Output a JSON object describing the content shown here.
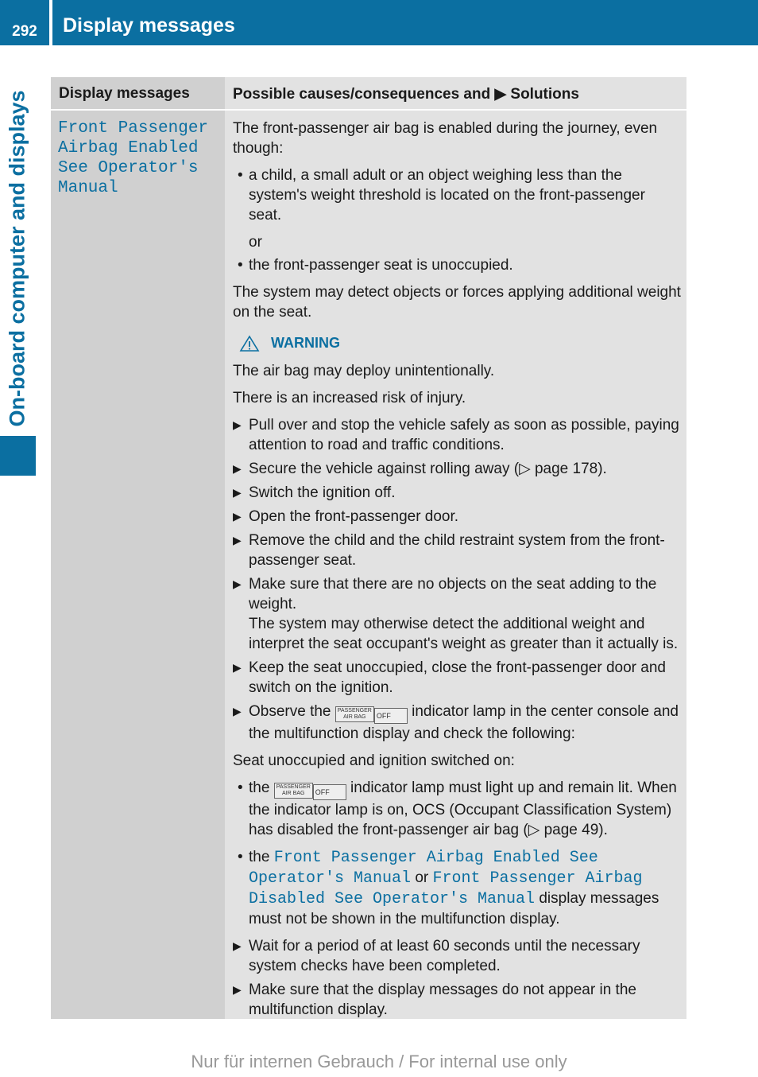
{
  "header": {
    "page_number": "292",
    "section_title": "Display messages"
  },
  "sidebar": {
    "label": "On-board computer and displays"
  },
  "colors": {
    "brand_blue": "#0b6fa1",
    "table_left_bg": "#d0d0d0",
    "table_right_bg": "#e2e2e2"
  },
  "table": {
    "headers": {
      "left": "Display messages",
      "right_prefix": "Possible causes/consequences and",
      "right_arrow": "▶",
      "right_suffix": "Solutions"
    },
    "row": {
      "message": "Front Passenger Airbag Enabled See Operator's Manual",
      "intro": "The front-passenger air bag is enabled during the journey, even though:",
      "bullet1": "a child, a small adult or an object weighing less than the system's weight threshold is located on the front-passenger seat.",
      "or": "or",
      "bullet2": "the front-passenger seat is unoccupied.",
      "detect": "The system may detect objects or forces applying additional weight on the seat.",
      "warning_label": "WARNING",
      "warning_icon": "warning-triangle-icon",
      "warning_text1": "The air bag may deploy unintentionally.",
      "warning_text2": "There is an increased risk of injury.",
      "steps": [
        "Pull over and stop the vehicle safely as soon as possible, paying attention to road and traffic conditions.",
        "Secure the vehicle against rolling away (▷ page 178).",
        "Switch the ignition off.",
        "Open the front-passenger door.",
        "Remove the child and the child restraint system from the front-passenger seat.",
        "Make sure that there are no objects on the seat adding to the weight.",
        "The system may otherwise detect the additional weight and interpret the seat occupant's weight as greater than it actually is.",
        "Keep the seat unoccupied, close the front-passenger door and switch on the ignition."
      ],
      "observe_prefix": "Observe the",
      "observe_suffix": "indicator lamp in the center console and the multifunction display and check the following:",
      "indicator_top": "PASSENGER",
      "indicator_bottom": "AIR BAG",
      "indicator_off": "OFF",
      "seat_line": "Seat unoccupied and ignition switched on:",
      "lamp_prefix": "the",
      "lamp_suffix": "indicator lamp must light up and remain lit. When the indicator lamp is on, OCS (Occupant Classification System) has disabled the front-passenger air bag (▷ page 49).",
      "msg_prefix": "the",
      "msg_enabled": "Front Passenger Airbag Enabled See Operator's Manual",
      "msg_or": "or",
      "msg_disabled": "Front Passenger Airbag Disabled See Operator's Manual",
      "msg_suffix": "display messages must not be shown in the multifunction display.",
      "final_steps": [
        "Wait for a period of at least 60 seconds until the necessary system checks have been completed.",
        "Make sure that the display messages do not appear in the multifunction display."
      ]
    }
  },
  "footer": {
    "text": "Nur für internen Gebrauch / For internal use only"
  }
}
